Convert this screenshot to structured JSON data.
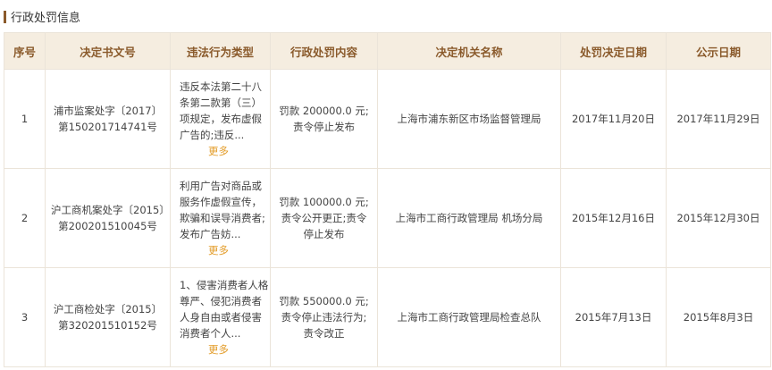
{
  "section": {
    "title": "行政处罚信息"
  },
  "columns": [
    "序号",
    "决定书文号",
    "违法行为类型",
    "行政处罚内容",
    "决定机关名称",
    "处罚决定日期",
    "公示日期"
  ],
  "more_label": "更多",
  "rows": [
    {
      "no": "1",
      "doc": "浦市监案处字〔2017〕第150201714741号",
      "violation": "违反本法第二十八条第二款第（三）项规定，发布虚假广告的;违反...",
      "content": "罚款 200000.0 元;责令停止发布",
      "org": "上海市浦东新区市场监督管理局",
      "decision_date": "2017年11月20日",
      "publish_date": "2017年11月29日"
    },
    {
      "no": "2",
      "doc": "沪工商机案处字〔2015〕第200201510045号",
      "violation": "利用广告对商品或服务作虚假宣传，欺骗和误导消费者;发布广告妨...",
      "content": "罚款 100000.0 元;责令公开更正;责令停止发布",
      "org": "上海市工商行政管理局 机场分局",
      "decision_date": "2015年12月16日",
      "publish_date": "2015年12月30日"
    },
    {
      "no": "3",
      "doc": "沪工商检处字〔2015〕第320201510152号",
      "violation": "1、侵害消费者人格尊严、侵犯消费者人身自由或者侵害消费者个人...",
      "content": "罚款 550000.0 元;责令停止违法行为;责令改正",
      "org": "上海市工商行政管理局检查总队",
      "decision_date": "2015年7月13日",
      "publish_date": "2015年8月3日"
    }
  ]
}
